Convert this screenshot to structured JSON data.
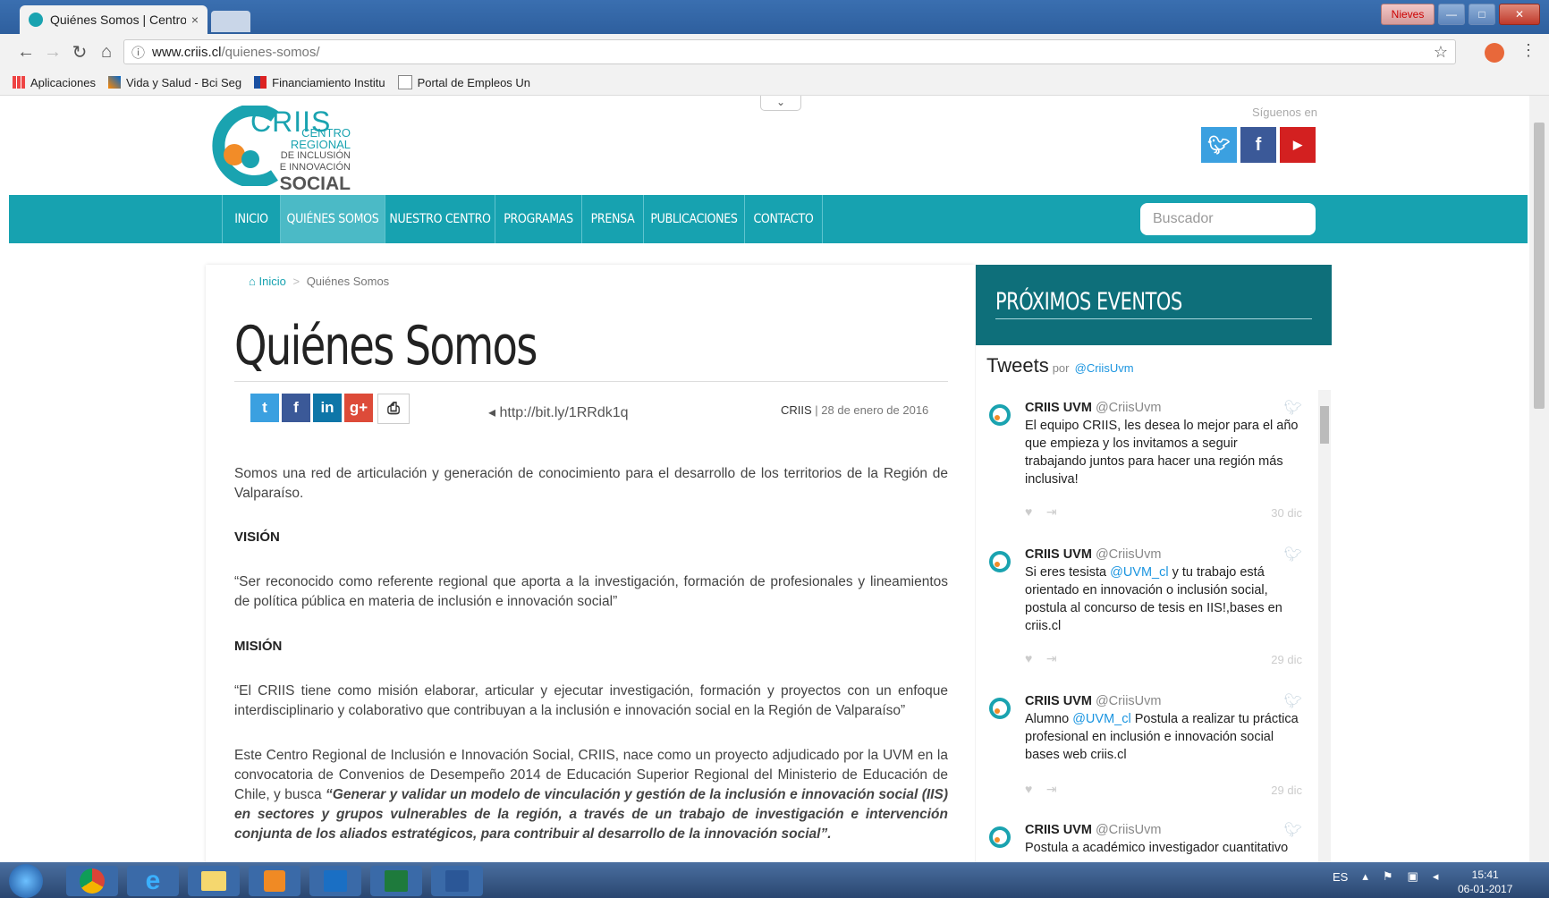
{
  "browser": {
    "tab_title": "Quiénes Somos | Centro",
    "tab_close": "×",
    "window_user": "Nieves",
    "url_host": "www.criis.cl",
    "url_path": "/quienes-somos/",
    "bookmarks": [
      "Aplicaciones",
      "Vida y Salud - Bci Seg",
      "Financiamiento Institu",
      "Portal de Empleos Un"
    ]
  },
  "header": {
    "logo_name": "CRIIS",
    "logo_line1": "CENTRO REGIONAL",
    "logo_line2": "DE INCLUSIÓN",
    "logo_line3": "E INNOVACIÓN",
    "logo_line4": "SOCIAL",
    "follow_text": "Síguenos en",
    "social_icons": [
      "twitter-icon",
      "facebook-icon",
      "youtube-icon"
    ]
  },
  "nav": {
    "items": [
      "INICIO",
      "QUIÉNES SOMOS",
      "NUESTRO CENTRO",
      "PROGRAMAS",
      "PRENSA",
      "PUBLICACIONES",
      "CONTACTO"
    ],
    "active": "QUIÉNES SOMOS",
    "search_placeholder": "Buscador"
  },
  "article": {
    "breadcrumb_home": "Inicio",
    "breadcrumb_sep": ">",
    "breadcrumb_current": "Quiénes Somos",
    "title": "Quiénes Somos",
    "short_url": "http://bit.ly/1RRdk1q",
    "author": "CRIIS",
    "date": "28 de enero de 2016",
    "intro": "Somos una red de articulación y generación de conocimiento para el desarrollo de los territorios de la Región de Valparaíso.",
    "vision_heading": "VISIÓN",
    "vision_text": "“Ser reconocido como referente regional que aporta a la investigación, formación de profesionales y lineamientos de política pública en materia de inclusión e innovación social”",
    "mision_heading": "MISIÓN",
    "mision_text": "“El CRIIS tiene como misión elaborar, articular y ejecutar investigación, formación y proyectos con un enfoque interdisciplinario y colaborativo que contribuyan a la inclusión e innovación social en la Región de Valparaíso”",
    "body_text": "Este Centro Regional de Inclusión e Innovación Social, CRIIS, nace como un proyecto adjudicado por la UVM en la convocatoria de Convenios de Desempeño 2014 de Educación Superior Regional del Ministerio de Educación de Chile, y busca ",
    "body_emphasis": "“Generar y validar un modelo de vinculación y gestión de la inclusión e innovación social (IIS) en sectores y grupos vulnerables de la región, a través de un trabajo de investigación e intervención conjunta de los aliados estratégicos, para contribuir al desarrollo de la innovación social”."
  },
  "sidebar": {
    "events_title": "PRÓXIMOS EVENTOS",
    "tweets_title": "Tweets",
    "tweets_por": "por",
    "tweets_handle": "@CriisUvm",
    "tweets": [
      {
        "name": "CRIIS UVM",
        "handle": "@CriisUvm",
        "text": "El equipo CRIIS, les desea lo mejor para el año que empieza y los invitamos a seguir trabajando juntos para hacer una región más inclusiva!",
        "date": "30 dic"
      },
      {
        "name": "CRIIS UVM",
        "handle": "@CriisUvm",
        "text_a": "Si eres tesista ",
        "link": "@UVM_cl",
        "text_b": " y tu trabajo está orientado en innovación o inclusión social, postula al concurso de tesis en IIS!,bases en criis.cl",
        "date": "29 dic"
      },
      {
        "name": "CRIIS UVM",
        "handle": "@CriisUvm",
        "text_a": "Alumno ",
        "link": "@UVM_cl",
        "text_b": " Postula a realizar tu práctica profesional en inclusión e innovación social bases web criis.cl",
        "date": "29 dic"
      },
      {
        "name": "CRIIS UVM",
        "handle": "@CriisUvm",
        "text": "Postula a académico investigador cuantitativo"
      }
    ]
  },
  "taskbar": {
    "lang": "ES",
    "time": "15:41",
    "date": "06-01-2017"
  },
  "colors": {
    "teal": "#17a2b0",
    "teal_dark": "#0e6f7a",
    "orange": "#f28c28"
  }
}
